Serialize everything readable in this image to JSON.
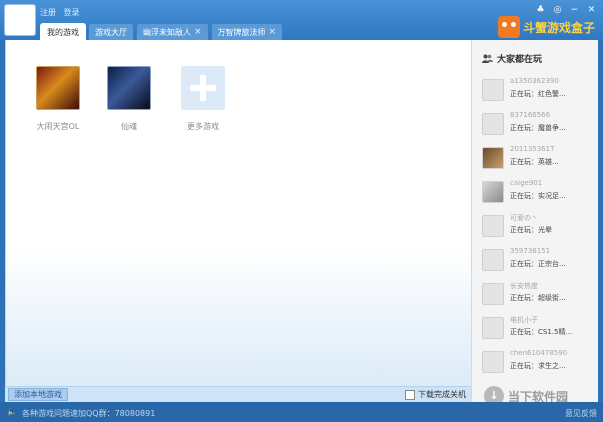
{
  "header": {
    "login_links": [
      "注册",
      "登录"
    ],
    "tabs": [
      {
        "label": "我的游戏",
        "closable": false,
        "active": true
      },
      {
        "label": "游戏大厅",
        "closable": false,
        "active": false
      },
      {
        "label": "幽浮未知敌人",
        "closable": true,
        "active": false
      },
      {
        "label": "万智牌旅法师",
        "closable": true,
        "active": false
      }
    ],
    "window_controls": [
      "skin-icon",
      "settings-icon",
      "minimize-icon",
      "close-icon"
    ],
    "brand": "斗蟹游戏盒子",
    "tab_close_glyph": "×"
  },
  "games": [
    {
      "label": "大闹天宫OL"
    },
    {
      "label": "仙魂"
    },
    {
      "label": "更多游戏"
    }
  ],
  "bottombar": {
    "add_local": "添加本地游戏",
    "download_shutdown": "下载完成关机"
  },
  "side": {
    "title": "大家都在玩",
    "players": [
      {
        "name": "a1350362390",
        "playing": "正在玩：红色警..."
      },
      {
        "name": "837166566",
        "playing": "正在玩：魔兽争..."
      },
      {
        "name": "201135361T",
        "playing": "正在玩：英雄...",
        "avatar": "photo1"
      },
      {
        "name": "caige901",
        "playing": "正在玩：实况足...",
        "avatar": "photo2"
      },
      {
        "name": "可爱の丶",
        "playing": "正在玩：光晕"
      },
      {
        "name": "359736151",
        "playing": "正在玩：正宗台..."
      },
      {
        "name": "长安热度",
        "playing": "正在玩：超级街..."
      },
      {
        "name": "电机小子",
        "playing": "正在玩：CS1.5精..."
      },
      {
        "name": "chen610478590",
        "playing": "正在玩：求生之..."
      }
    ]
  },
  "status": {
    "text": "各种游戏问题速加QQ群：78080891",
    "feedback": "意见反馈"
  },
  "watermark": "当下软件园"
}
